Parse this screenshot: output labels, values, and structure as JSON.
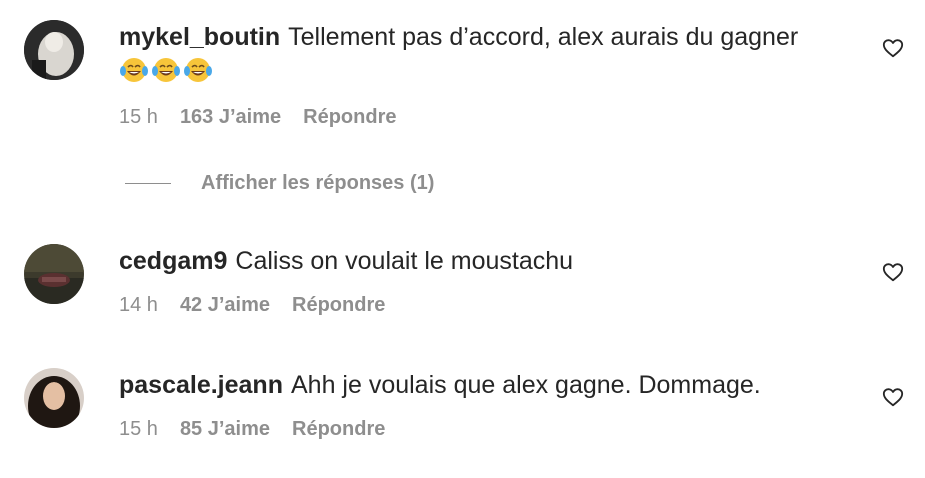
{
  "comments": [
    {
      "username": "mykel_boutin",
      "text": "Tellement pas d’accord, alex aurais du gagner",
      "emoji": [
        "face-with-tears-of-joy",
        "face-with-tears-of-joy",
        "face-with-tears-of-joy"
      ],
      "time": "15 h",
      "likes": "163 J’aime",
      "reply": "Répondre"
    },
    {
      "username": "cedgam9",
      "text": "Caliss on voulait le moustachu",
      "time": "14 h",
      "likes": "42 J’aime",
      "reply": "Répondre"
    },
    {
      "username": "pascale.jeann",
      "text": "Ahh je voulais que alex gagne. Dommage.",
      "time": "15 h",
      "likes": "85 J’aime",
      "reply": "Répondre"
    }
  ],
  "view_replies": {
    "label": "Afficher les réponses (1)"
  },
  "icons": {
    "like": "heart-outline-icon"
  },
  "colors": {
    "primary_text": "#262626",
    "secondary_text": "#8e8e8e"
  }
}
